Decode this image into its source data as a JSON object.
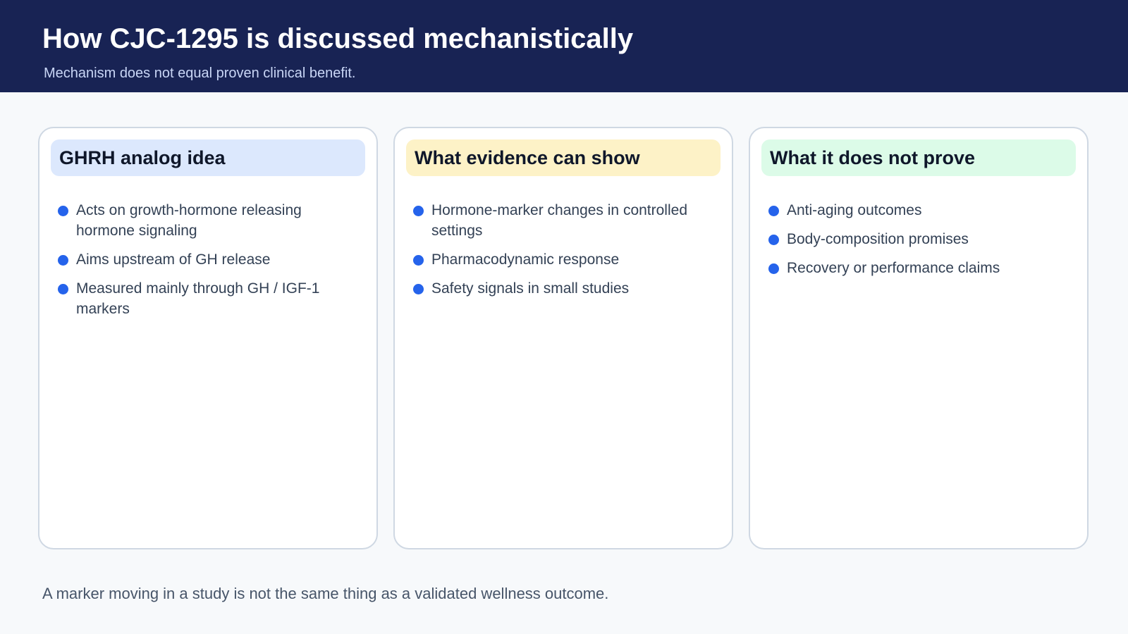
{
  "header": {
    "title": "How CJC-1295 is discussed mechanistically",
    "subtitle": "Mechanism does not equal proven clinical benefit."
  },
  "cards": [
    {
      "title": "GHRH analog idea",
      "header_color": "#dce8fd",
      "items": [
        "Acts on growth-hormone releasing hormone signaling",
        "Aims upstream of GH release",
        "Measured mainly through GH / IGF-1 markers"
      ]
    },
    {
      "title": "What evidence can show",
      "header_color": "#fdf2c7",
      "items": [
        "Hormone-marker changes in controlled settings",
        "Pharmacodynamic response",
        "Safety signals in small studies"
      ]
    },
    {
      "title": "What it does not prove",
      "header_color": "#dcfbe8",
      "items": [
        "Anti-aging outcomes",
        "Body-composition promises",
        "Recovery or performance claims"
      ]
    }
  ],
  "footer": {
    "note": "A marker moving in a study is not the same thing as a validated wellness outcome."
  },
  "colors": {
    "header_bg": "#182354",
    "bullet": "#2563eb",
    "card_border": "#cfd8e3"
  }
}
